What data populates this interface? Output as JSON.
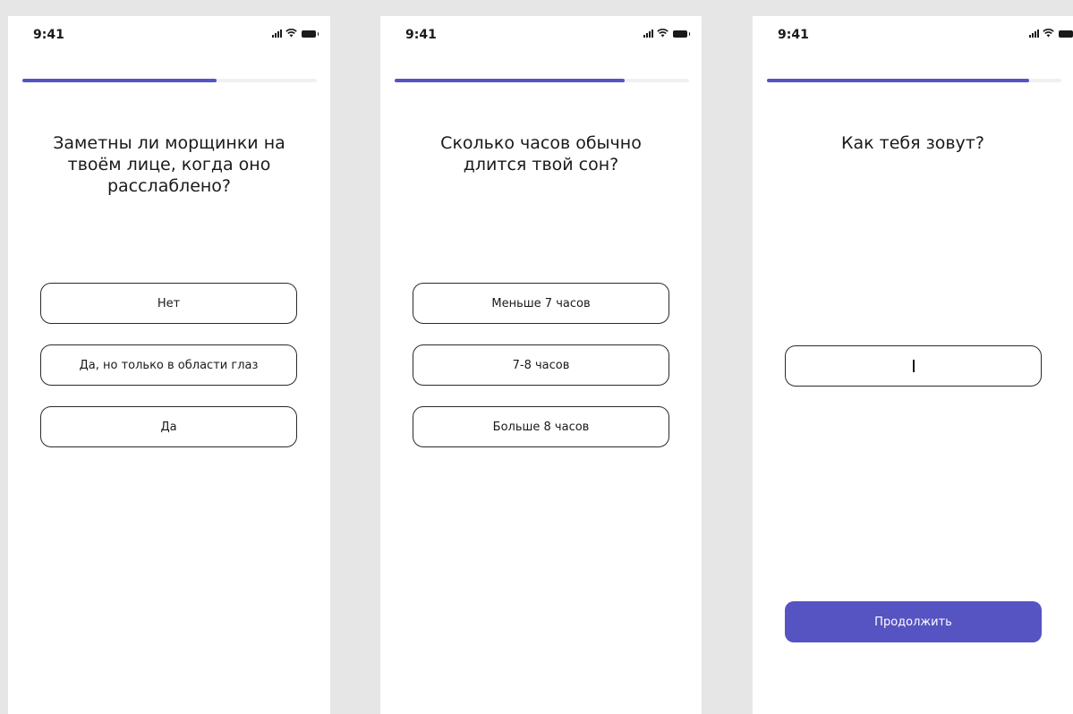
{
  "colors": {
    "accent": "#5653c2",
    "track": "#f0f0f3",
    "background": "#e6e6e6",
    "card": "#ffffff"
  },
  "screens": [
    {
      "time": "9:41",
      "progress_fraction": 0.66,
      "question": "Заметны ли морщинки на\nтвоём лице, когда оно\nрасслаблено?",
      "options": [
        "Нет",
        "Да, но только в области глаз",
        "Да"
      ]
    },
    {
      "time": "9:41",
      "progress_fraction": 0.78,
      "question": "Сколько часов обычно\nдлится твой сон?",
      "options": [
        "Меньше 7 часов",
        "7-8 часов",
        "Больше 8 часов"
      ]
    },
    {
      "time": "9:41",
      "progress_fraction": 0.89,
      "question": "Как тебя зовут?",
      "input_value": "",
      "continue_label": "Продолжить"
    }
  ],
  "icons": {
    "signal": "signal-icon",
    "wifi": "wifi-icon",
    "battery": "battery-icon"
  }
}
